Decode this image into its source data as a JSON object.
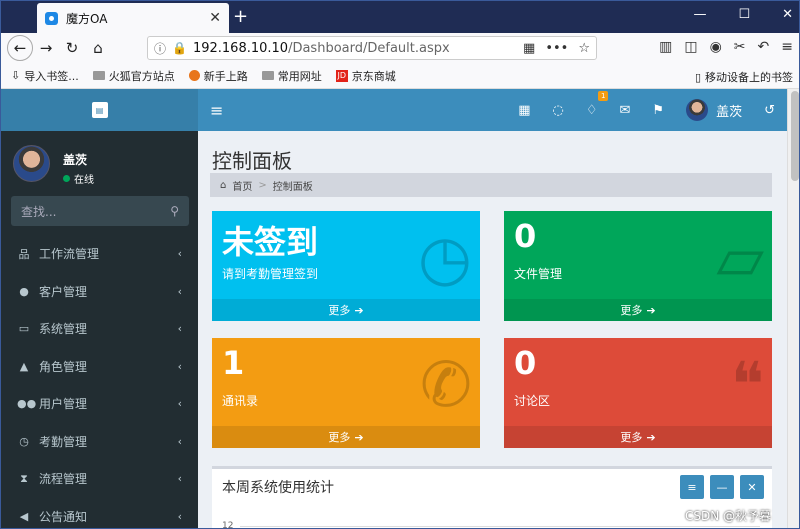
{
  "browser": {
    "tab_title": "魔方OA",
    "tab_close": "✕",
    "new_tab": "+",
    "url_host": "192.168.10.10",
    "url_path": "/Dashboard/Default.aspx",
    "bookmarks": [
      {
        "label": "导入书签..."
      },
      {
        "label": "火狐官方站点"
      },
      {
        "label": "新手上路"
      },
      {
        "label": "常用网址"
      },
      {
        "label": "京东商城"
      }
    ],
    "mobile_bookmarks": "移动设备上的书签"
  },
  "sidebar": {
    "user_name": "盖茨",
    "status": "在线",
    "search_placeholder": "查找...",
    "items": [
      {
        "label": "工作流管理",
        "icon": "sitemap-icon"
      },
      {
        "label": "客户管理",
        "icon": "user-icon"
      },
      {
        "label": "系统管理",
        "icon": "monitor-icon"
      },
      {
        "label": "角色管理",
        "icon": "graduation-icon"
      },
      {
        "label": "用户管理",
        "icon": "users-icon"
      },
      {
        "label": "考勤管理",
        "icon": "clock-icon"
      },
      {
        "label": "流程管理",
        "icon": "hourglass-icon"
      },
      {
        "label": "公告通知",
        "icon": "bullhorn-icon"
      }
    ]
  },
  "header": {
    "user_name": "盖茨",
    "notification_count": "1"
  },
  "main": {
    "title": "控制面板",
    "breadcrumb": {
      "home": "首页",
      "current": "控制面板"
    },
    "boxes": [
      {
        "value": "未签到",
        "label": "请到考勤管理签到",
        "more": "更多",
        "color": "#00c0ef"
      },
      {
        "value": "0",
        "label": "文件管理",
        "more": "更多",
        "color": "#00a65a"
      },
      {
        "value": "1",
        "label": "通讯录",
        "more": "更多",
        "color": "#f39c12"
      },
      {
        "value": "0",
        "label": "讨论区",
        "more": "更多",
        "color": "#dd4b39"
      }
    ],
    "panel": {
      "title": "本周系统使用统计",
      "y_tick": "12"
    }
  },
  "watermark": "CSDN @秋予暮"
}
